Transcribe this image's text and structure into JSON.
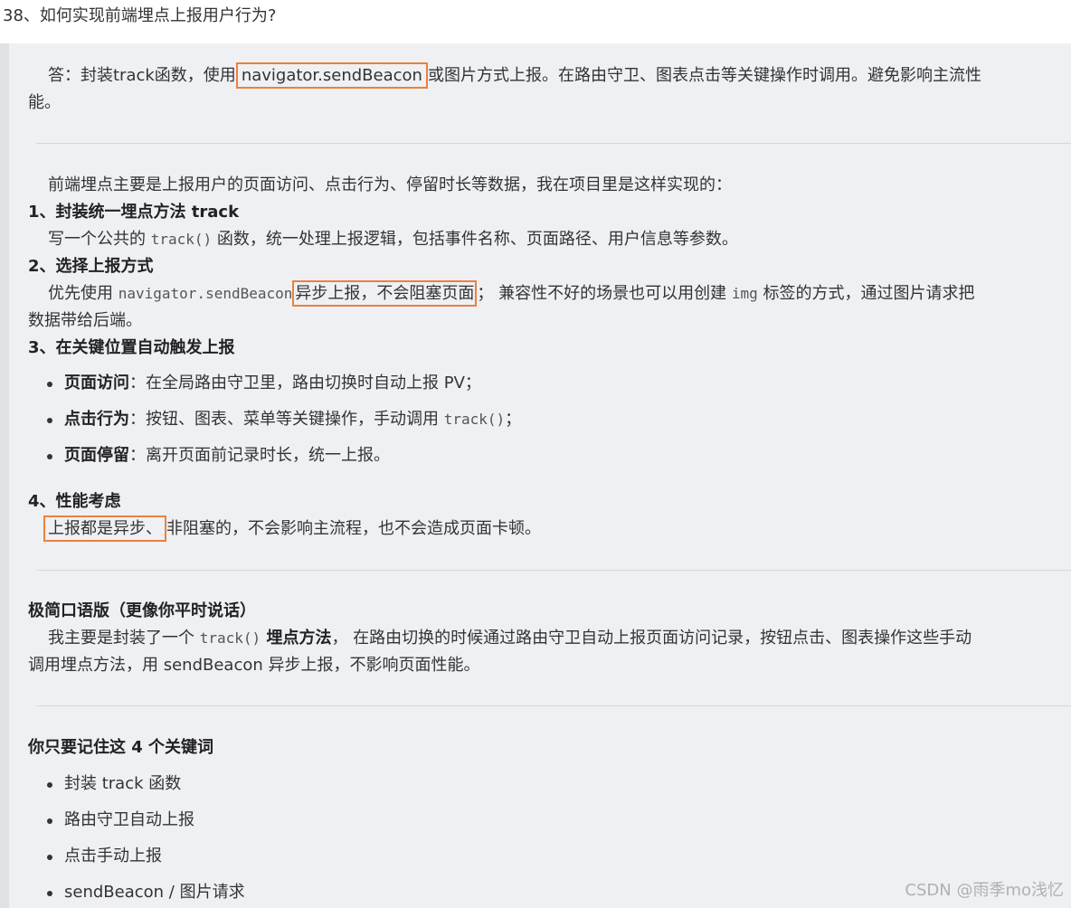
{
  "question_title": "38、如何实现前端埋点上报用户行为?",
  "answer": {
    "p1_a": "答：封装track函数，使用",
    "p1_code": "navigator.sendBeacon",
    "p1_b": "或图片方式上报。在路由守卫、图表点击等关键操作时调用。避免影响主流性",
    "p1_c": "能。"
  },
  "detail": {
    "intro": "前端埋点主要是上报用户的页面访问、点击行为、停留时长等数据，我在项目里是这样实现的：",
    "h1": "1、封装统一埋点方法 track",
    "s1_a": "写一个公共的 ",
    "s1_code": "track()",
    "s1_b": " 函数，统一处理上报逻辑，包括事件名称、页面路径、用户信息等参数。",
    "h2": "2、选择上报方式",
    "s2_a": "优先使用 ",
    "s2_code": "navigator.sendBeacon",
    "s2_box": "异步上报，不会阻塞页面",
    "s2_b": "； 兼容性不好的场景也可以用创建 ",
    "s2_code2": "img",
    "s2_c": " 标签的方式，通过图片请求把",
    "s2_d": "数据带给后端。",
    "h3": "3、在关键位置自动触发上报",
    "b1_bold": "页面访问",
    "b1_text": "：在全局路由守卫里，路由切换时自动上报 PV；",
    "b2_bold": "点击行为",
    "b2_text": "：按钮、图表、菜单等关键操作，手动调用 ",
    "b2_code": "track()",
    "b2_end": "；",
    "b3_bold": "页面停留",
    "b3_text": "：离开页面前记录时长，统一上报。",
    "h4": "4、性能考虑",
    "s4_box": "上报都是异步、",
    "s4_text": "非阻塞的，不会影响主流程，也不会造成页面卡顿。"
  },
  "oral": {
    "title": "极简口语版（更像你平时说话）",
    "a": "我主要是封装了一个 ",
    "code": "track()",
    "bold": " 埋点方法",
    "b": "， 在路由切换的时候通过路由守卫自动上报页面访问记录，按钮点击、图表操作这些手动",
    "c": "调用埋点方法，用 sendBeacon 异步上报，不影响页面性能。"
  },
  "keywords": {
    "title": "你只要记住这 4 个关键词",
    "items": [
      "封装 track 函数",
      "路由守卫自动上报",
      "点击手动上报",
      "sendBeacon / 图片请求"
    ]
  },
  "watermark": "CSDN @雨季mo浅忆",
  "colors": {
    "highlight_box": "#ee7f3b",
    "quote_bg": "#eef0f4",
    "quote_bar": "#dfe2e5"
  }
}
